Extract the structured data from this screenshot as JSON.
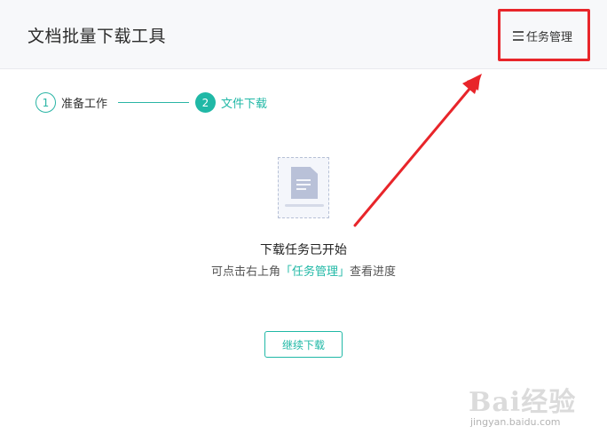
{
  "header": {
    "title": "文档批量下载工具",
    "task_management_label": "任务管理"
  },
  "steps": [
    {
      "number": "1",
      "label": "准备工作",
      "state": "done"
    },
    {
      "number": "2",
      "label": "文件下载",
      "state": "active"
    }
  ],
  "status": {
    "title": "下载任务已开始",
    "hint_prefix": "可点击右上角",
    "hint_link": "「任务管理」",
    "hint_suffix": "查看进度"
  },
  "buttons": {
    "continue_label": "继续下载"
  },
  "watermark": {
    "text": "Bai经验",
    "url": "jingyan.baidu.com"
  },
  "colors": {
    "accent": "#20b8a6",
    "highlight_red": "#e8252a",
    "header_bg": "#f7f8fa"
  },
  "icons": {
    "task_management": "list-icon",
    "placeholder": "document-icon"
  }
}
